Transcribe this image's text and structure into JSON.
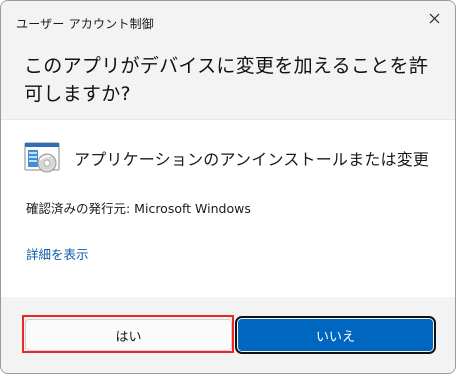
{
  "dialog": {
    "window_title": "ユーザー アカウント制御",
    "question": "このアプリがデバイスに変更を加えることを許可しますか?",
    "close_icon": "close-icon"
  },
  "app": {
    "icon": "installer-icon",
    "name": "アプリケーションのアンインストールまたは変更"
  },
  "publisher": "確認済みの発行元: Microsoft Windows",
  "details_link": "詳細を表示",
  "buttons": {
    "yes_label": "はい",
    "no_label": "いいえ"
  },
  "colors": {
    "primary_button": "#0067c0",
    "link": "#0a5aa8",
    "highlight": "#e8262b"
  }
}
